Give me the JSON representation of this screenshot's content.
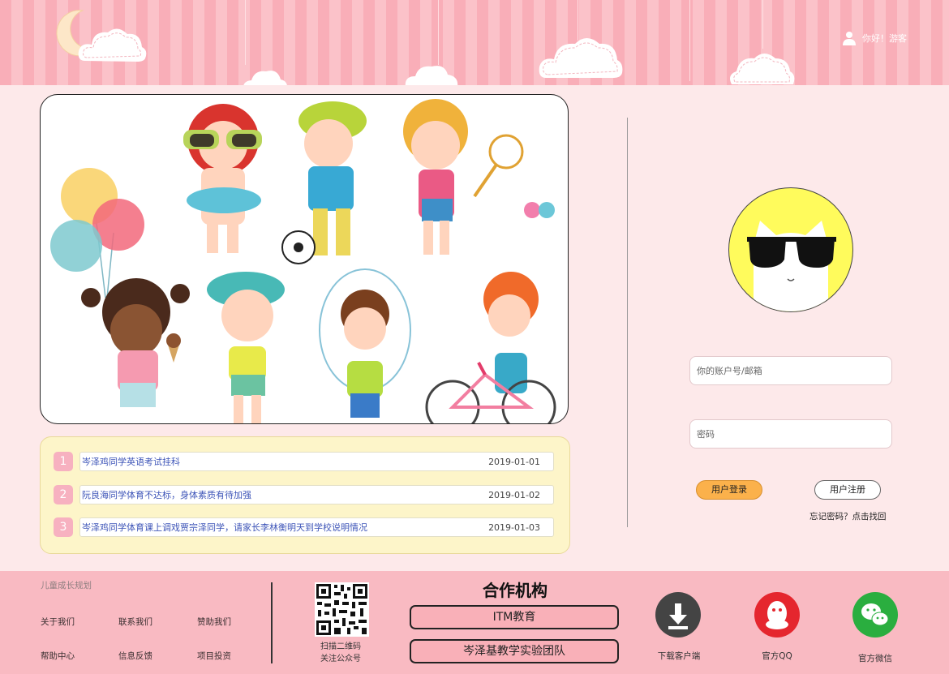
{
  "header": {
    "greeting": "你好！游客"
  },
  "news": [
    {
      "index": "1",
      "title": "岑泽鸡同学英语考试挂科",
      "date": "2019-01-01"
    },
    {
      "index": "2",
      "title": "阮良海同学体育不达标，身体素质有待加强",
      "date": "2019-01-02"
    },
    {
      "index": "3",
      "title": "岑泽鸡同学体育课上调戏贾宗泽同学，请家长李林衡明天到学校说明情况",
      "date": "2019-01-03"
    }
  ],
  "login": {
    "account_placeholder": "你的账户号/邮箱",
    "password_placeholder": "密码",
    "login_label": "用户登录",
    "register_label": "用户注册",
    "forgot_label": "忘记密码？点击找回"
  },
  "footer": {
    "section_title": "儿童成长规划",
    "links": [
      "关于我们",
      "联系我们",
      "赞助我们",
      "帮助中心",
      "信息反馈",
      "项目投资"
    ],
    "qr_line1": "扫描二维码",
    "qr_line2": "关注公众号",
    "partners_title": "合作机构",
    "partners": [
      "ITM教育",
      "岑泽基教学实验团队"
    ],
    "download_label": "下载客户端",
    "qq_label": "官方QQ",
    "wechat_label": "官方微信"
  },
  "colors": {
    "header_stripe_a": "#f9aeb8",
    "header_stripe_b": "#fbc2c9",
    "page_bg": "#fde9ea",
    "news_bg": "#fdf5c9",
    "login_button": "#fbb14b",
    "footer_bg": "#f9bac2",
    "qq_red": "#e5262e",
    "wechat_green": "#2aae3f",
    "download_gray": "#444444"
  }
}
